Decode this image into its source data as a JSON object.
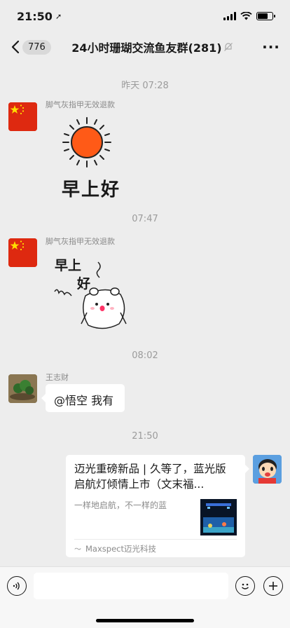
{
  "status_bar": {
    "time": "21:50",
    "location_glyph": "➚"
  },
  "nav": {
    "unread_count": "776",
    "title": "24小时珊瑚交流鱼友群(281)",
    "more_glyph": "···"
  },
  "messages": {
    "t1": "昨天 07:28",
    "m1_sender": "脚气灰指甲无效退款",
    "m1_sticker_text": "早上好",
    "t2": "07:47",
    "m2_sender": "脚气灰指甲无效退款",
    "m2_sticker_text_1": "早上",
    "m2_sticker_text_2": "好",
    "t3": "08:02",
    "m3_sender": "王志财",
    "m3_text": "@悟空 我有",
    "t4": "21:50",
    "m4_title": "迈光重磅新品 | 久等了，蓝光版启航灯倾情上市（文末福...",
    "m4_desc": "一样地启航，不一样的蓝",
    "m4_source": "Maxspect迈光科技"
  },
  "icons": {
    "back": "chevron-left-icon",
    "mute": "bell-off-icon",
    "more": "more-icon",
    "voice": "voice-icon",
    "emoji": "emoji-icon",
    "plus": "plus-icon"
  }
}
